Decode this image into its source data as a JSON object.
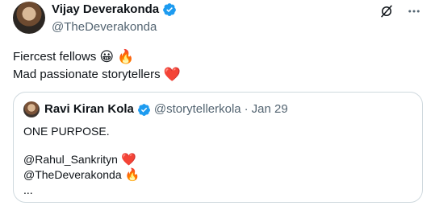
{
  "author": {
    "name": "Vijay Deverakonda",
    "handle": "@TheDeverakonda"
  },
  "actions": {
    "grok_icon": "grok-icon",
    "more_icon": "more-icon"
  },
  "tweet": {
    "line1": "Fiercest fellows",
    "line1_emoji1": "😀",
    "line1_emoji2": "🔥",
    "line2": "Mad passionate storytellers",
    "line2_emoji": "❤️"
  },
  "quote": {
    "name": "Ravi Kiran Kola",
    "handle": "@storytellerkola",
    "separator": "·",
    "date": "Jan 29",
    "lines": {
      "l1": "ONE PURPOSE.",
      "l2": "@Rahul_Sankrityn",
      "l2_emoji": "❤️",
      "l3": "@TheDeverakonda",
      "l3_emoji": "🔥",
      "l4": "..."
    }
  },
  "colors": {
    "verified": "#1d9bf0",
    "text": "#0f1419",
    "muted": "#536471",
    "border": "#cfd9de",
    "heart": "#e0245e",
    "fire": "#f4900c"
  }
}
